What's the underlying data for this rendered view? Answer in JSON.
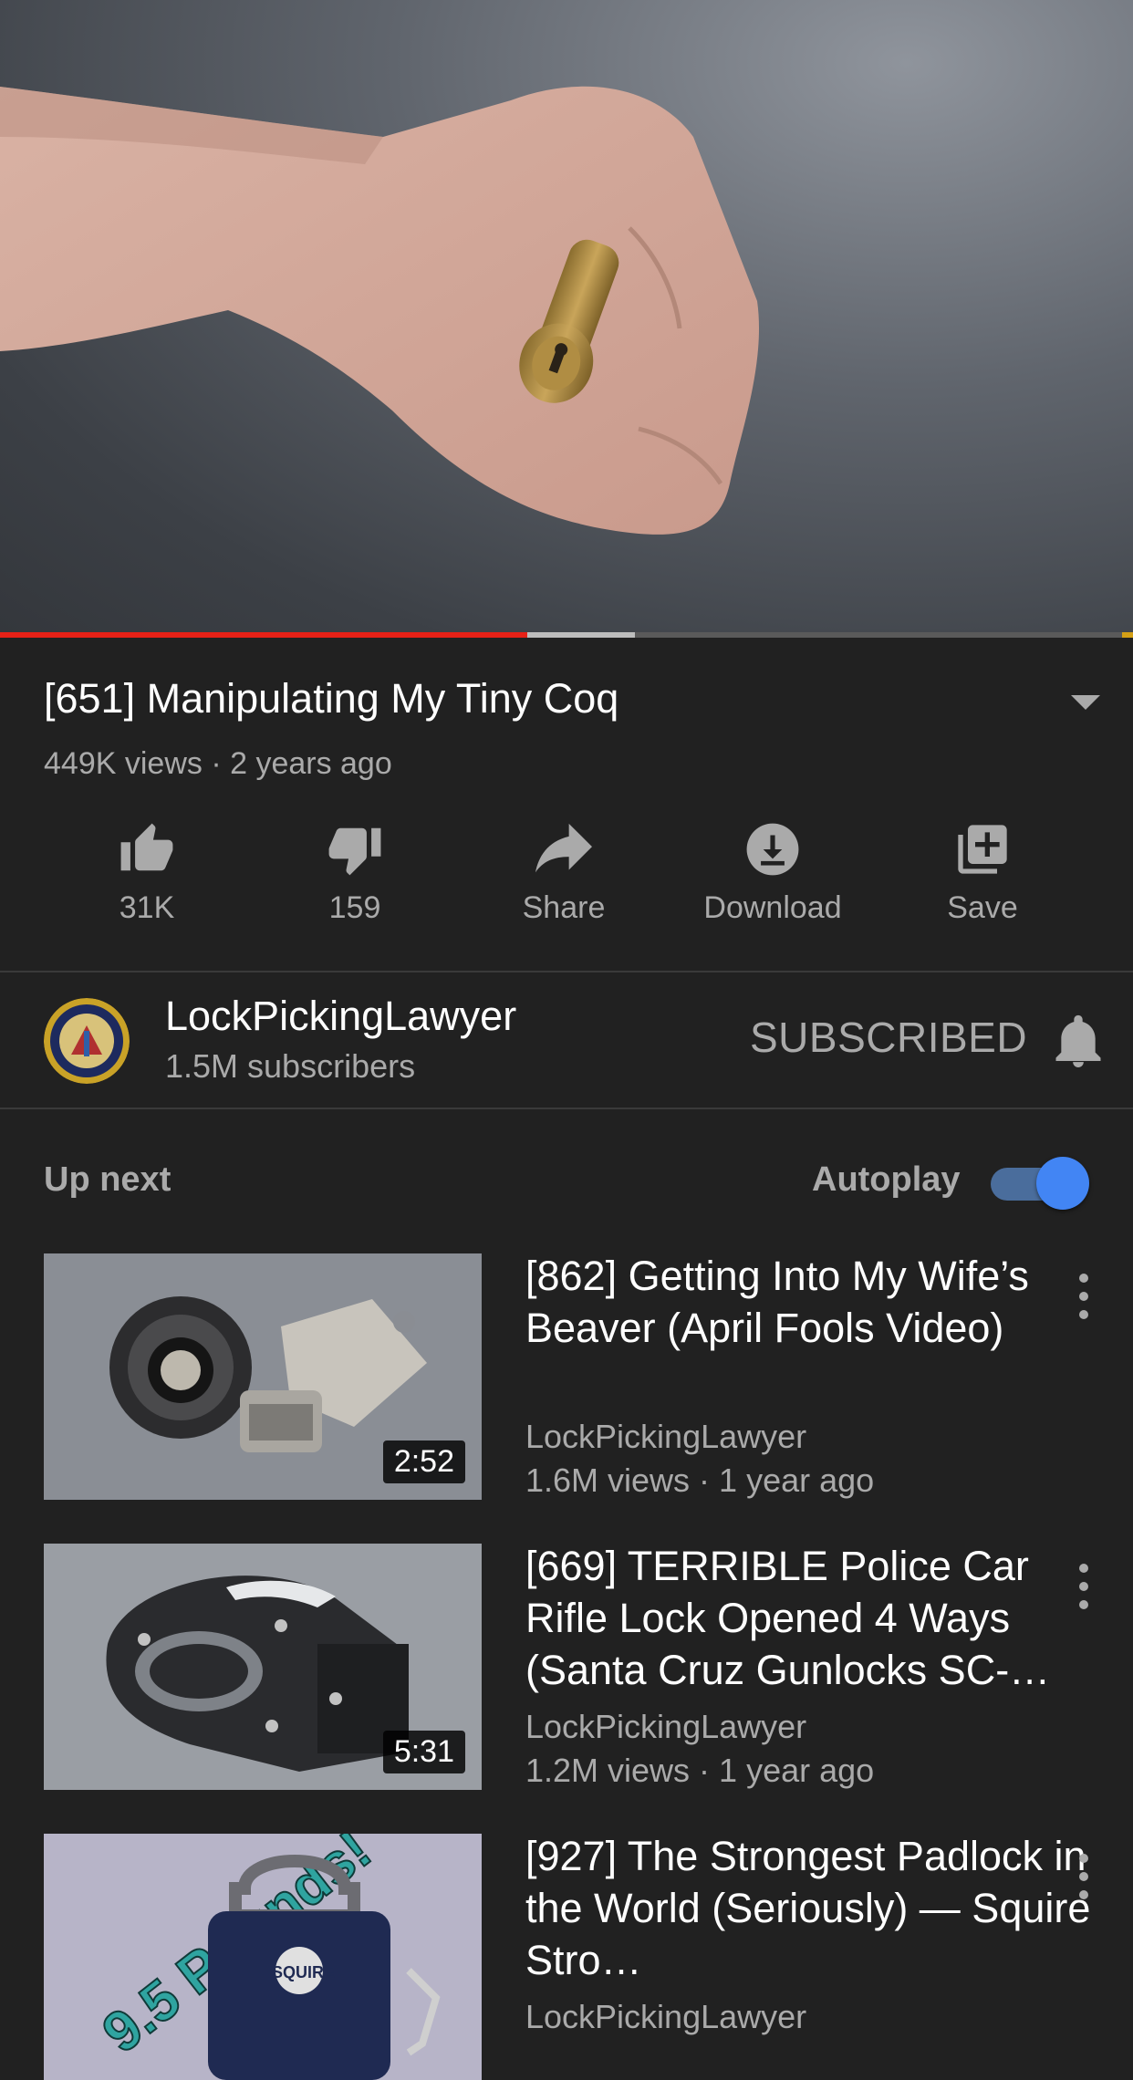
{
  "video": {
    "title": "[651] Manipulating My Tiny Coq",
    "meta": "449K views · 2 years ago",
    "progress_played": 0.465,
    "progress_buffered": 0.56
  },
  "actions": {
    "like": "31K",
    "dislike": "159",
    "share": "Share",
    "download": "Download",
    "save": "Save"
  },
  "channel": {
    "name": "LockPickingLawyer",
    "subscribers": "1.5M subscribers",
    "subscribe_state": "SUBSCRIBED"
  },
  "upnext": {
    "heading": "Up next",
    "autoplay_label": "Autoplay",
    "autoplay_on": true,
    "items": [
      {
        "title": "[862] Getting Into My Wife’s Beaver (April Fools Video)",
        "channel": "LockPickingLawyer",
        "meta": "1.6M views · 1 year ago",
        "duration": "2:52"
      },
      {
        "title": "[669] TERRIBLE Police Car Rifle Lock Opened 4 Ways (Santa Cruz Gunlocks SC-…",
        "channel": "LockPickingLawyer",
        "meta": "1.2M views · 1 year ago",
        "duration": "5:31"
      },
      {
        "title": "[927] The Strongest Padlock in the World (Seriously) — Squire Stro…",
        "channel": "LockPickingLawyer",
        "meta": "",
        "duration": "",
        "thumb_text": "9.5 Pounds!",
        "thumb_badge": "SQUIRE"
      }
    ]
  },
  "colors": {
    "background": "#212121",
    "progress_played": "#e62117",
    "toggle": "#4285f4",
    "secondary_text": "#aaaaaa"
  }
}
